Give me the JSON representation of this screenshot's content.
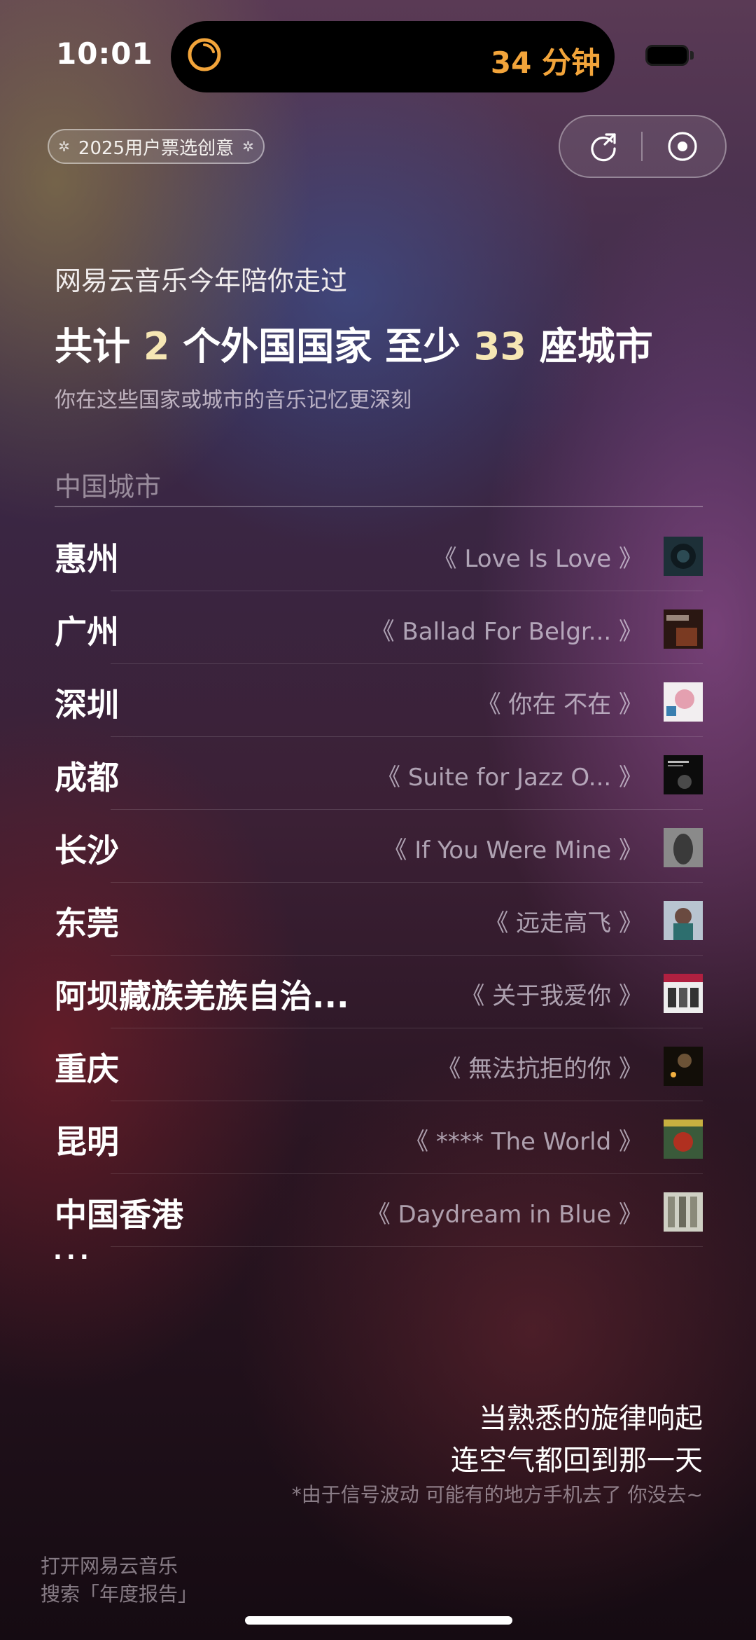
{
  "status_bar": {
    "time": "10:01",
    "activity_text": "34 分钟",
    "activity_icon": "timer-ring-icon",
    "battery_icon": "battery-icon"
  },
  "badge": {
    "label": "2025用户票选创意",
    "spark_icon": "sparkle-icon"
  },
  "actions": {
    "share_icon": "share-icon",
    "record_icon": "record-icon"
  },
  "header": {
    "intro": "网易云音乐今年陪你走过",
    "headline_prefix": "共计 ",
    "country_count": "2",
    "headline_mid": " 个外国国家 至少 ",
    "city_count": "33",
    "headline_suffix": " 座城市",
    "subline": "你在这些国家或城市的音乐记忆更深刻"
  },
  "section_title": "中国城市",
  "cities": [
    {
      "city": "惠州",
      "song": "《 Love Is Love 》",
      "cover": "album-cover-love-is-love"
    },
    {
      "city": "广州",
      "song": "《 Ballad For Belgr... 》",
      "cover": "album-cover-ballad"
    },
    {
      "city": "深圳",
      "song": "《 你在 不在 》",
      "cover": "album-cover-ni-zai"
    },
    {
      "city": "成都",
      "song": "《 Suite for Jazz O... 》",
      "cover": "album-cover-suite-jazz"
    },
    {
      "city": "长沙",
      "song": "《 If You Were Mine 》",
      "cover": "album-cover-if-you-were-mine"
    },
    {
      "city": "东莞",
      "song": "《 远走高飞 》",
      "cover": "album-cover-yuan-zou"
    },
    {
      "city": "阿坝藏族羌族自治...",
      "song": "《 关于我爱你 》",
      "cover": "album-cover-guan-yu"
    },
    {
      "city": "重庆",
      "song": "《 無法抗拒的你 》",
      "cover": "album-cover-wu-fa"
    },
    {
      "city": "昆明",
      "song": "《 **** The World 》",
      "cover": "album-cover-the-world"
    },
    {
      "city": "中国香港",
      "song": "《 Daydream in Blue 》",
      "cover": "album-cover-daydream"
    }
  ],
  "more_label": "...",
  "footer": {
    "tagline_line1": "当熟悉的旋律响起",
    "tagline_line2": "连空气都回到那一天",
    "note": "*由于信号波动 可能有的地方手机去了 你没去~",
    "hint_line1": "打开网易云音乐",
    "hint_line2": "搜索「年度报告」"
  },
  "colors": {
    "activity": "#f2a43a",
    "highlight_number": "#f6e6b4"
  }
}
